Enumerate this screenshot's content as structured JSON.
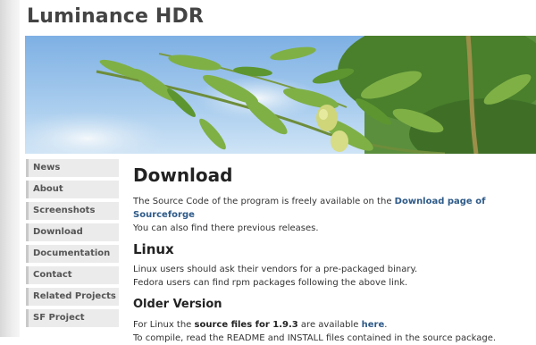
{
  "site": {
    "title": "Luminance HDR"
  },
  "sidebar": {
    "items": [
      {
        "label": "News"
      },
      {
        "label": "About"
      },
      {
        "label": "Screenshots"
      },
      {
        "label": "Download"
      },
      {
        "label": "Documentation"
      },
      {
        "label": "Contact"
      },
      {
        "label": "Related Projects"
      },
      {
        "label": "SF Project"
      }
    ]
  },
  "main": {
    "title": "Download",
    "intro_text": "The Source Code of the program is freely available on the ",
    "intro_link": "Download page of Sourceforge",
    "intro_line2": "You can also find there previous releases.",
    "linux": {
      "heading": "Linux",
      "line1": "Linux users should ask their vendors for a pre-packaged binary.",
      "line2": "Fedora users can find rpm packages following the above link."
    },
    "older": {
      "heading": "Older Version",
      "text_a": "For Linux the ",
      "text_bold": "source files for 1.9.3",
      "text_b": " are available ",
      "link": "here",
      "text_end": ".",
      "line2": "To compile, read the README and INSTALL files contained in the source package."
    }
  },
  "colors": {
    "link": "#2e5a88",
    "sky": "#9fc3e8",
    "foliage": "#4f8a2c"
  }
}
